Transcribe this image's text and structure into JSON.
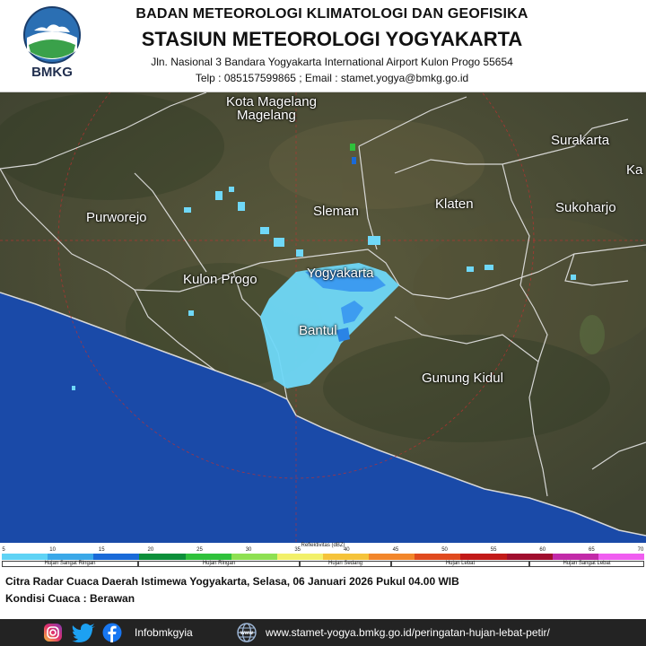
{
  "header": {
    "logo_text": "BMKG",
    "agency": "BADAN METEOROLOGI KLIMATOLOGI DAN GEOFISIKA",
    "station": "STASIUN METEOROLOGI YOGYAKARTA",
    "address": "Jln. Nasional 3 Bandara Yogyakarta International Airport Kulon Progo 55654",
    "contact": "Telp : 085157599865   ;   Email : stamet.yogya@bmkg.go.id"
  },
  "map": {
    "cities": [
      {
        "id": "kota-magelang",
        "name": "Kota Magelang"
      },
      {
        "id": "magelang",
        "name": "Magelang"
      },
      {
        "id": "surakarta",
        "name": "Surakarta"
      },
      {
        "id": "karanganyar",
        "name": "Ka"
      },
      {
        "id": "purworejo",
        "name": "Purworejo"
      },
      {
        "id": "sleman",
        "name": "Sleman"
      },
      {
        "id": "klaten",
        "name": "Klaten"
      },
      {
        "id": "sukoharjo",
        "name": "Sukoharjo"
      },
      {
        "id": "kulon-progo",
        "name": "Kulon Progo"
      },
      {
        "id": "yogyakarta",
        "name": "Yogyakarta"
      },
      {
        "id": "bantul",
        "name": "Bantul"
      },
      {
        "id": "gunung-kidul",
        "name": "Gunung Kidul"
      }
    ]
  },
  "legend": {
    "title": "Reflektivitas (dBZ)",
    "ticks": [
      "5",
      "10",
      "15",
      "20",
      "25",
      "30",
      "35",
      "40",
      "45",
      "50",
      "55",
      "60",
      "65",
      "70"
    ],
    "colors": [
      "#5fd3f5",
      "#3aa8e8",
      "#1a6ad8",
      "#0c8f3a",
      "#2fc13b",
      "#8ee052",
      "#f2f06a",
      "#f5c33a",
      "#f2862a",
      "#e04a1e",
      "#c21a18",
      "#a00e2e",
      "#c22aa8",
      "#f05ef0"
    ],
    "categories": [
      "Hujan Sangat Ringan",
      "Hujan Ringan",
      "Hujan Sedang",
      "Hujan Lebat",
      "Hujan Sangat Lebat"
    ]
  },
  "caption": {
    "line1": "Citra Radar Cuaca Daerah Istimewa Yogyakarta, Selasa, 06 Januari 2026  Pukul 04.00  WIB",
    "line2": "Kondisi Cuaca : Berawan"
  },
  "footer": {
    "social_handle": "Infobmkgyia",
    "website": "www.stamet-yogya.bmkg.go.id/peringatan-hujan-lebat-petir/",
    "icons": [
      "instagram-icon",
      "twitter-icon",
      "facebook-icon",
      "globe-icon"
    ]
  }
}
